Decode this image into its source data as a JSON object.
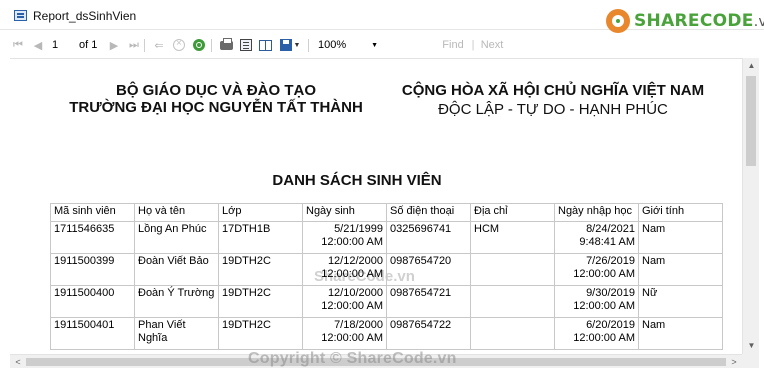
{
  "window": {
    "title": "Report_dsSinhVien"
  },
  "brand": {
    "name": "SHARECODE",
    "suffix": ".vn"
  },
  "toolbar": {
    "page_value": "1",
    "of_label": "of 1",
    "zoom_value": "100%",
    "find_label": "Find",
    "separator": "|",
    "next_label": "Next"
  },
  "header_left": {
    "line1": "BỘ GIÁO DỤC VÀ ĐÀO TẠO",
    "line2": "TRƯỜNG ĐẠI HỌC NGUYỄN TẤT THÀNH"
  },
  "header_right": {
    "line1": "CỘNG HÒA XÃ HỘI CHỦ NGHĨA VIỆT NAM",
    "line2": "ĐỘC LẬP - TỰ DO - HẠNH PHÚC"
  },
  "report_title": "DANH SÁCH SINH VIÊN",
  "table": {
    "columns": [
      "Mã sinh viên",
      "Họ và tên",
      "Lớp",
      "Ngày sinh",
      "Số điện thoại",
      "Địa chỉ",
      "Ngày nhập học",
      "Giới tính"
    ],
    "rows": [
      {
        "ma": "1711546635",
        "ten": "Lồng An Phúc",
        "lop": "17DTH1B",
        "ngaysinh_date": "5/21/1999",
        "ngaysinh_time": "12:00:00 AM",
        "sdt": "0325696741",
        "diachi": "HCM",
        "nhaphoc_date": "8/24/2021",
        "nhaphoc_time": "9:48:41 AM",
        "gioitinh": "Nam"
      },
      {
        "ma": "1911500399",
        "ten": "Đoàn Viết Bảo",
        "lop": "19DTH2C",
        "ngaysinh_date": "12/12/2000",
        "ngaysinh_time": "12:00:00 AM",
        "sdt": "0987654720",
        "diachi": "",
        "nhaphoc_date": "7/26/2019",
        "nhaphoc_time": "12:00:00 AM",
        "gioitinh": "Nam"
      },
      {
        "ma": "1911500400",
        "ten": "Đoàn Ý Trường",
        "lop": "19DTH2C",
        "ngaysinh_date": "12/10/2000",
        "ngaysinh_time": "12:00:00 AM",
        "sdt": "0987654721",
        "diachi": "",
        "nhaphoc_date": "9/30/2019",
        "nhaphoc_time": "12:00:00 AM",
        "gioitinh": "Nữ"
      },
      {
        "ma": "1911500401",
        "ten": "Phan Viết Nghĩa",
        "lop": "19DTH2C",
        "ngaysinh_date": "7/18/2000",
        "ngaysinh_time": "12:00:00 AM",
        "sdt": "0987654722",
        "diachi": "",
        "nhaphoc_date": "6/20/2019",
        "nhaphoc_time": "12:00:00 AM",
        "gioitinh": "Nam"
      }
    ]
  },
  "watermark": "Copyright © ShareCode.vn",
  "watermark_mid": "ShareCode.vn"
}
